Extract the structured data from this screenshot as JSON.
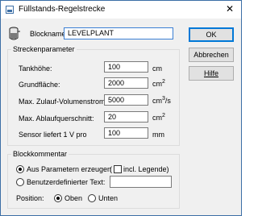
{
  "window": {
    "title": "Füllstands-Regelstrecke",
    "close_glyph": "✕"
  },
  "block": {
    "label": "Blockname:",
    "value": "LEVELPLANT"
  },
  "buttons": {
    "ok": "OK",
    "cancel": "Abbrechen",
    "help": "Hilfe"
  },
  "params": {
    "legend": "Streckenparameter",
    "rows": [
      {
        "label": "Tankhöhe:",
        "value": "100",
        "unit": "cm",
        "unit_sup": ""
      },
      {
        "label": "Grundfläche:",
        "value": "2000",
        "unit": "cm",
        "unit_sup": "2"
      },
      {
        "label": "Max. Zulauf-Volumenstrom:",
        "value": "5000",
        "unit": "cm",
        "unit_sup": "3",
        "unit_suffix": "/s"
      },
      {
        "label": "Max. Ablaufquerschnitt:",
        "value": "20",
        "unit": "cm",
        "unit_sup": "2"
      },
      {
        "label": "Sensor liefert 1 V pro",
        "value": "100",
        "unit": "mm",
        "unit_sup": ""
      }
    ]
  },
  "comment": {
    "legend": "Blockkommentar",
    "from_params_label": "Aus Parametern erzeugen",
    "from_params_selected": true,
    "incl_legend_prefix": "(",
    "incl_legend_label": "incl. Legende)",
    "incl_legend_checked": false,
    "custom_label": "Benutzerdefinierter Text:",
    "custom_selected": false,
    "custom_value": "",
    "position_label": "Position:",
    "pos_top_label": "Oben",
    "pos_top_selected": true,
    "pos_bottom_label": "Unten",
    "pos_bottom_selected": false
  }
}
